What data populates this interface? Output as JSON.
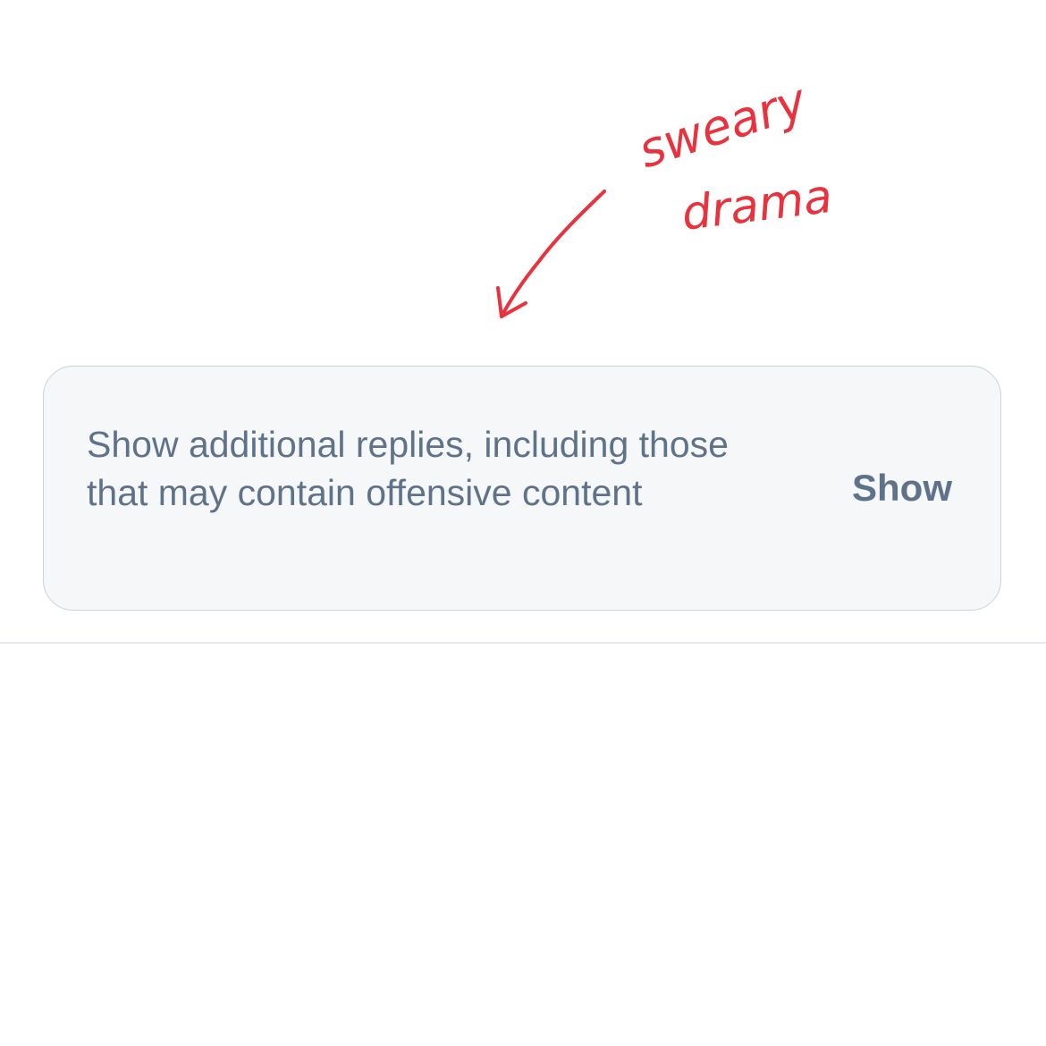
{
  "annotation": {
    "text_line_1": "sweary",
    "text_line_2": "drama",
    "color": "#e8333e"
  },
  "notice": {
    "message": "Show additional replies, including those that may contain offensive content",
    "button_label": "Show"
  },
  "colors": {
    "card_background": "#f5f7f9",
    "card_border": "#c9d3de",
    "text": "#5e7389",
    "divider": "#e6eaee"
  }
}
